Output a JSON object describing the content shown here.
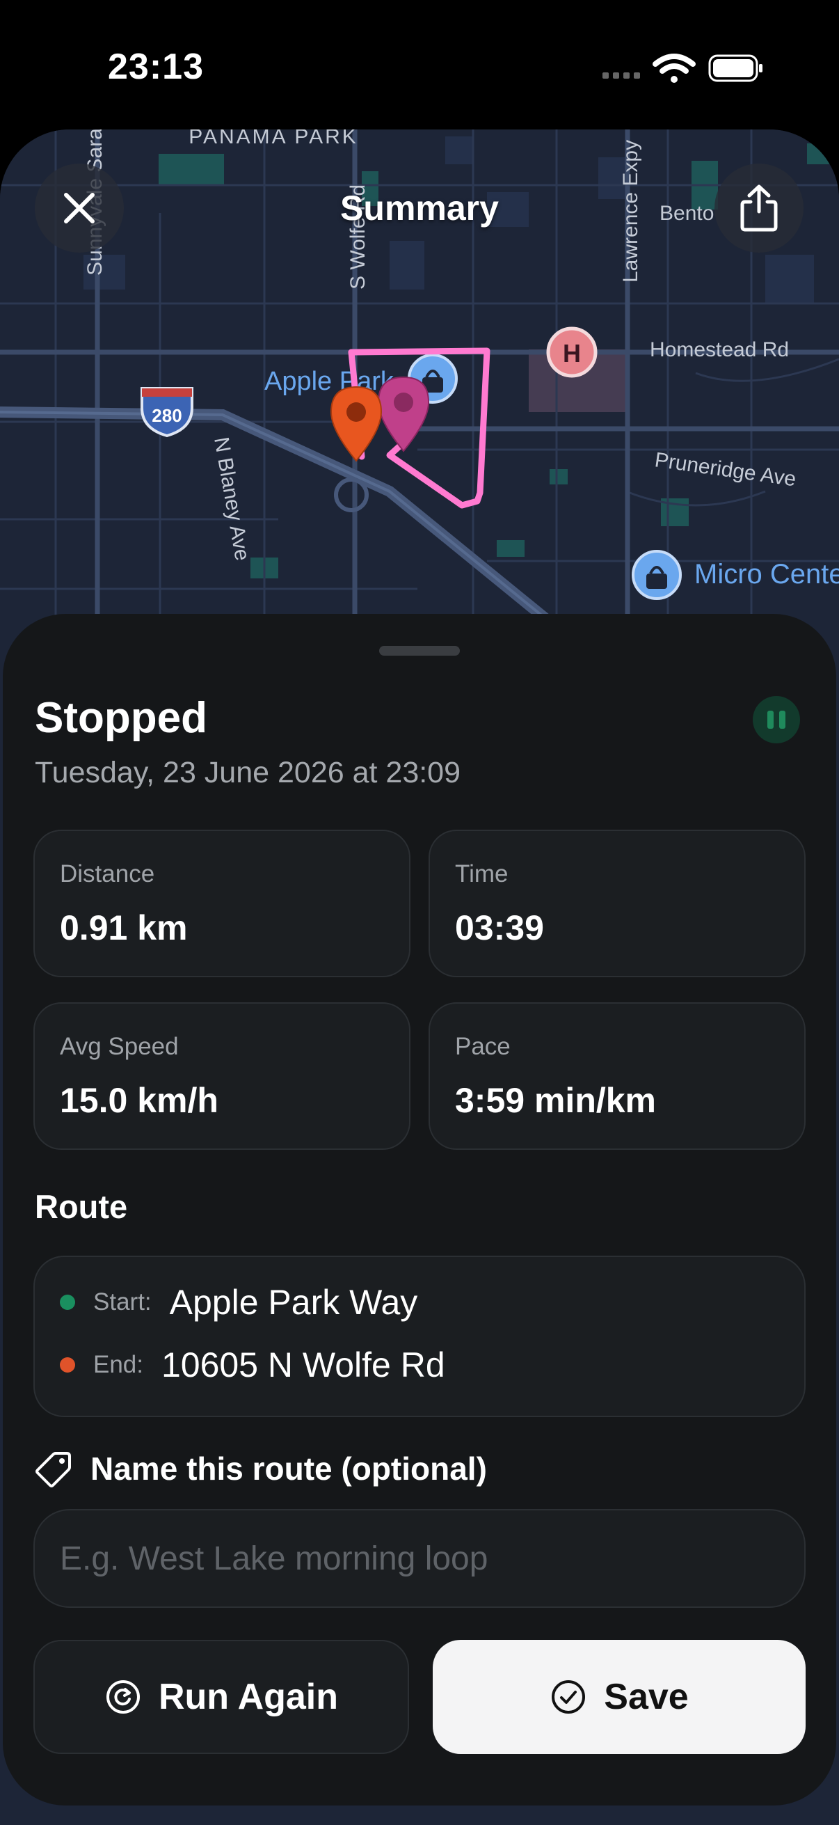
{
  "status_bar": {
    "time": "23:13"
  },
  "map": {
    "title": "Summary",
    "labels": {
      "panama_park": "PANAMA PARK",
      "apple_park": "Apple Park",
      "homestead_rd": "Homestead Rd",
      "pruneridge_ave": "Pruneridge Ave",
      "micro_center": "Micro Center",
      "n_blaney_ave": "N Blaney Ave",
      "s_wolfe_rd": "S Wolfe Rd",
      "lawrence_expy": "Lawrence Expy",
      "sunnyvale_saratoga": "Sunnyvale Sara",
      "bento": "Bento",
      "interstate": "280",
      "hospital": "H"
    },
    "route_color": "#ff7ad0",
    "start_pin_color": "#e8561f",
    "end_pin_color": "#c0408a"
  },
  "sheet": {
    "title": "Stopped",
    "date": "Tuesday, 23 June 2026 at 23:09",
    "stats": [
      {
        "label": "Distance",
        "value": "0.91 km"
      },
      {
        "label": "Time",
        "value": "03:39"
      },
      {
        "label": "Avg Speed",
        "value": "15.0 km/h"
      },
      {
        "label": "Pace",
        "value": "3:59 min/km"
      }
    ],
    "route": {
      "heading": "Route",
      "start_label": "Start:",
      "start_value": "Apple Park Way",
      "end_label": "End:",
      "end_value": "10605 N Wolfe Rd",
      "start_dot_color": "#1a8f5f",
      "end_dot_color": "#e0532a"
    },
    "name_route": {
      "label": "Name this route (optional)",
      "placeholder": "E.g. West Lake morning loop",
      "value": ""
    },
    "buttons": {
      "run_again": "Run Again",
      "save": "Save"
    }
  }
}
